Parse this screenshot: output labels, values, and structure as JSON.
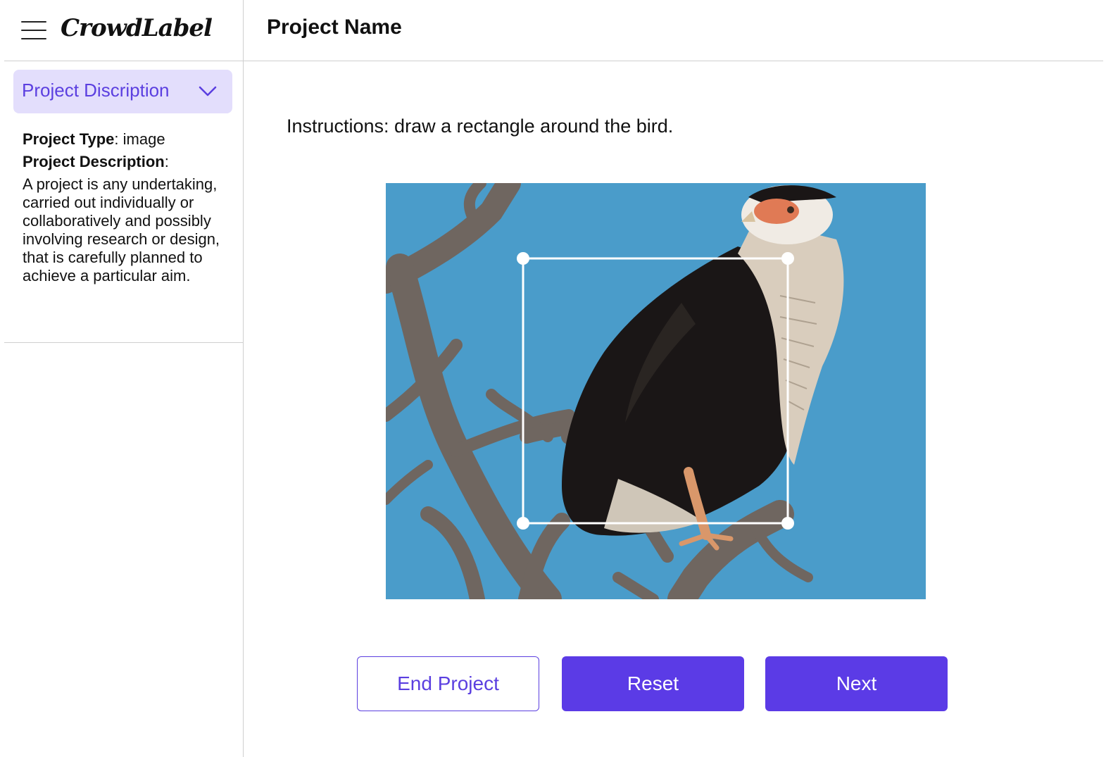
{
  "app": {
    "logo": "CrowdLabel",
    "menu_icon": "hamburger-menu-icon"
  },
  "sidebar": {
    "accordion": {
      "label": "Project Discription",
      "icon": "chevron-down-icon",
      "expanded": true
    },
    "project_type_label": "Project Type",
    "project_type_value": ": image",
    "project_description_label": "Project Description",
    "project_description_colon": ":",
    "project_description_text": "A project is any undertaking, carried out individually or collaboratively and possibly involving research or design, that is carefully planned to achieve a particular aim."
  },
  "header": {
    "title": "Project Name"
  },
  "main": {
    "instructions": "Instructions: draw a rectangle around the bird.",
    "image": {
      "subject": "crested caracara bird perched on bare branch against blue sky"
    },
    "buttons": {
      "end_project": "End Project",
      "reset": "Reset",
      "next": "Next"
    }
  },
  "colors": {
    "accent": "#5b3be6",
    "accent_light": "#e3defc",
    "sky": "#4a9cca",
    "divider": "#cfcfcf"
  }
}
